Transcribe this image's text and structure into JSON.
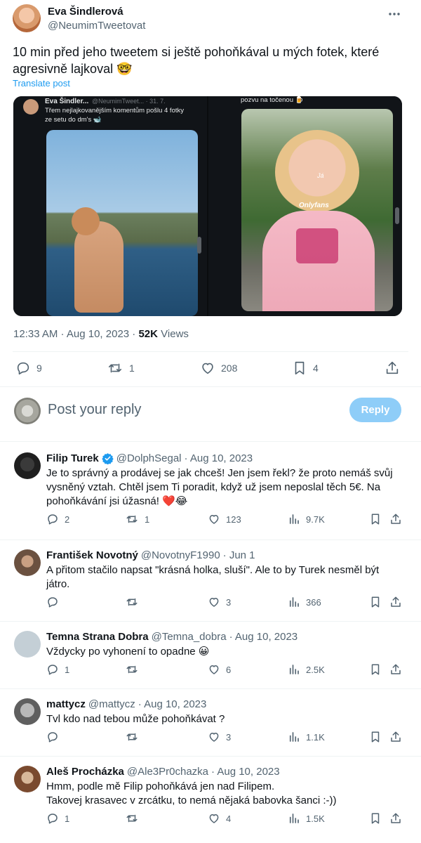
{
  "main_tweet": {
    "author_name": "Eva Šindlerová",
    "author_handle": "@NeumimTweetovat",
    "text": "10 min před jeho tweetem si ještě pohoňkával u mých fotek, které agresivně lajkoval 🤓",
    "translate_label": "Translate post",
    "time": "12:33 AM · Aug 10, 2023 ·",
    "views_count": "52K",
    "views_label": "Views",
    "stats": {
      "replies": "9",
      "reposts": "1",
      "likes": "208",
      "bookmarks": "4"
    },
    "media_left": {
      "author": "Eva Šindler...",
      "handle": "@NeumimTweet... · 31. 7.",
      "text": "Třem nejlajkovanějším komentům pošlu 4 fotky ze setu do dm's 🐋"
    },
    "media_right": {
      "top_text": "pozvu na točenou 🍺",
      "overlay_ja": "Já",
      "overlay_onlyfans": "Onlyfans"
    }
  },
  "composer": {
    "placeholder": "Post your reply",
    "button_label": "Reply"
  },
  "replies": [
    {
      "name": "Filip Turek",
      "verified": true,
      "handle": "@DolphSegal",
      "date": "· Aug 10, 2023",
      "text": "Je to správný a prodávej se jak chceš! Jen jsem řekl? že proto nemáš svůj vysněný vztah. Chtěl jsem Ti poradit, když už jsem neposlal těch 5€. Na pohoňkávání jsi úžasná! ❤️😂",
      "replies": "2",
      "reposts": "1",
      "likes": "123",
      "views": "9.7K"
    },
    {
      "name": "František Novotný",
      "verified": false,
      "handle": "@NovotnyF1990",
      "date": "· Jun 1",
      "text": "A přitom stačilo napsat \"krásná holka, sluší\". Ale to by Turek nesměl být játro.",
      "replies": "",
      "reposts": "",
      "likes": "3",
      "views": "366"
    },
    {
      "name": "Temna Strana Dobra",
      "verified": false,
      "handle": "@Temna_dobra",
      "date": "· Aug 10, 2023",
      "text": "Vždycky po vyhonení to opadne 😀",
      "replies": "1",
      "reposts": "",
      "likes": "6",
      "views": "2.5K"
    },
    {
      "name": "mattycz",
      "verified": false,
      "handle": "@mattycz",
      "date": "· Aug 10, 2023",
      "text": "Tvl kdo nad tebou může pohoňkávat ?",
      "replies": "",
      "reposts": "",
      "likes": "3",
      "views": "1.1K"
    },
    {
      "name": "Aleš Procházka",
      "verified": false,
      "handle": "@Ale3Pr0chazka",
      "date": "· Aug 10, 2023",
      "text": "Hmm, podle mě Filip pohoňkává jen nad Filipem.\nTakovej krasavec v zrcátku, to nemá nějaká babovka šanci :-))",
      "replies": "1",
      "reposts": "",
      "likes": "4",
      "views": "1.5K"
    }
  ],
  "colors": {
    "accent": "#1d9bf0",
    "reply_button_bg": "#8ecdf8",
    "muted": "#536471",
    "divider": "#eff3f4",
    "heart": "#e0245e"
  }
}
